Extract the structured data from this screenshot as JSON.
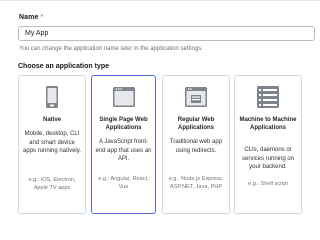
{
  "form": {
    "name_label": "Name",
    "name_required_marker": "*",
    "name_value": "My App",
    "name_help": "You can change the application name later in the application settings.",
    "type_heading": "Choose an application type"
  },
  "app_types": [
    {
      "title": "Native",
      "description": "Mobile, desktop, CLI and smart device apps running natively.",
      "examples": "e.g.: iOS, Electron, Apple TV apps",
      "icon": "mobile-device-icon",
      "selected": false
    },
    {
      "title": "Single Page Web Applications",
      "description": "A JavaScript front-end app that uses an API.",
      "examples": "e.g.: Angular, React, Vue",
      "icon": "browser-window-icon",
      "selected": true
    },
    {
      "title": "Regular Web Applications",
      "description": "Traditional web app using redirects.",
      "examples": "e.g.: Node.js Express, ASP.NET, Java, PHP",
      "icon": "web-server-icon",
      "selected": false
    },
    {
      "title": "Machine to Machine Applications",
      "description": "CLIs, daemons or services running on your backend.",
      "examples": "e.g.: Shell script",
      "icon": "server-list-icon",
      "selected": false
    }
  ],
  "colors": {
    "selected_border": "#5567d6",
    "required_marker": "#d03c3c",
    "icon_gray": "#7e858d"
  }
}
